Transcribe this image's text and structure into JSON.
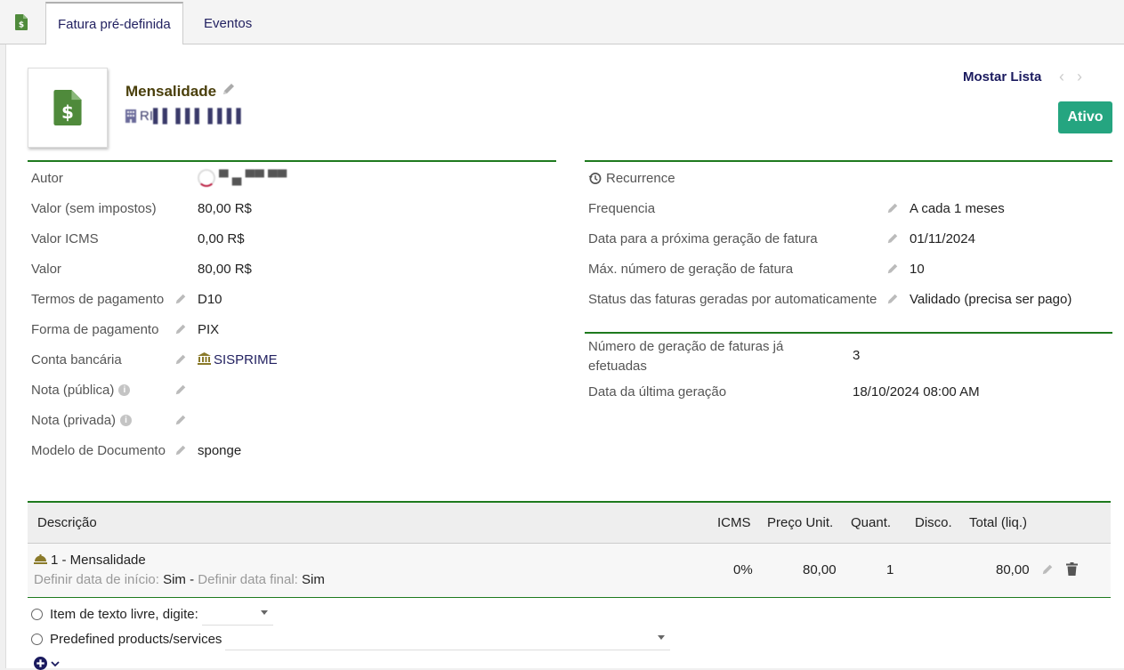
{
  "tabs": [
    {
      "label": "Fatura pré-definida",
      "active": true
    },
    {
      "label": "Eventos",
      "active": false
    }
  ],
  "header": {
    "title": "Mensalidade",
    "company": "RI▌▌ ▌▌▌ ▌▌▌▌",
    "show_list": "Mostar Lista",
    "status": "Ativo"
  },
  "left_fields": [
    {
      "label": "Autor",
      "value": "▀ ▄ ▀▀ ▀▀",
      "edit": false
    },
    {
      "label": "Valor (sem impostos)",
      "value": "80,00 R$",
      "edit": false
    },
    {
      "label": "Valor ICMS",
      "value": "0,00 R$",
      "edit": false
    },
    {
      "label": "Valor",
      "value": "80,00 R$",
      "edit": false
    },
    {
      "label": "Termos de pagamento",
      "value": "D10",
      "edit": true
    },
    {
      "label": "Forma de pagamento",
      "value": "PIX",
      "edit": true
    },
    {
      "label": "Conta bancária",
      "value": "SISPRIME",
      "edit": true
    },
    {
      "label": "Nota (pública)",
      "value": "",
      "edit": true
    },
    {
      "label": "Nota (privada)",
      "value": "",
      "edit": true
    },
    {
      "label": "Modelo de Documento",
      "value": "sponge",
      "edit": true
    }
  ],
  "recurrence": {
    "title": "Recurrence",
    "fields": [
      {
        "label": "Frequencia",
        "value": "A cada 1 meses"
      },
      {
        "label": "Data para a próxima geração de fatura",
        "value": "01/11/2024"
      },
      {
        "label": "Máx. número de geração de fatura",
        "value": "10"
      },
      {
        "label": "Status das faturas geradas por automaticamente",
        "value": "Validado (precisa ser pago)"
      }
    ]
  },
  "generation": {
    "count_label_1": "Número de geração de faturas já",
    "count_label_2": "efetuadas",
    "count_value": "3",
    "last_label": "Data da última geração",
    "last_value": "18/10/2024 08:00 AM"
  },
  "lines_table": {
    "headers": {
      "description": "Descrição",
      "vat": "ICMS",
      "unit_price": "Preço Unit.",
      "qty": "Quant.",
      "discount": "Disco.",
      "total": "Total (liq.)"
    },
    "rows": [
      {
        "label": "1 - Mensalidade",
        "start_label": "Definir data de início:",
        "start_value": "Sim",
        "sep": "-",
        "end_label": "Definir data final:",
        "end_value": "Sim",
        "vat": "0%",
        "unit_price": "80,00",
        "qty": "1",
        "discount": "",
        "total": "80,00"
      }
    ]
  },
  "add_line": {
    "free_text_label": "Item de texto livre, digite:",
    "predefined_label": "Predefined products/services"
  },
  "colors": {
    "accent_green": "#1e7a1e",
    "status_green": "#25a580",
    "link": "#232261"
  }
}
